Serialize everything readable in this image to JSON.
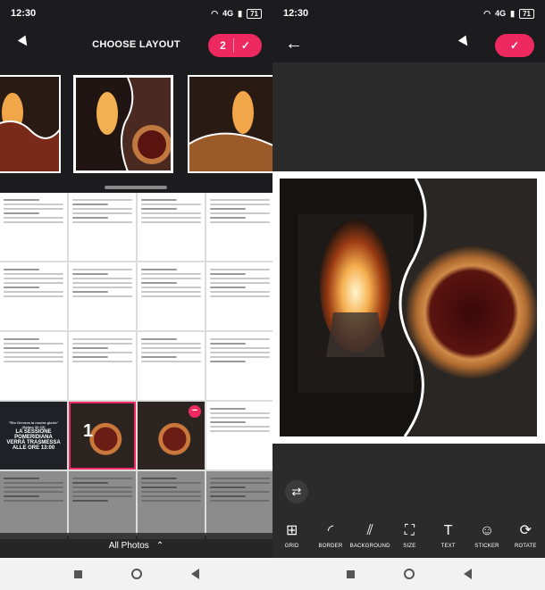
{
  "status": {
    "time_left": "12:30",
    "time_right": "12:30",
    "battery": "71",
    "network": "4G"
  },
  "left": {
    "title": "CHOOSE LAYOUT",
    "selected_count": "2",
    "check": "✓",
    "banner_lines": [
      "\"Rio Genova la nostra gloria\"",
      "(Salmo 30:15)",
      "LA SESSIONE POMERIDIANA",
      "VERRÀ TRASMESSA",
      "ALLE ORE 13:00"
    ],
    "selected_number": "1",
    "all_photos_label": "All Photos",
    "chevron": "⌃"
  },
  "right": {
    "back": "←",
    "check": "✓",
    "shuffle": "⇄",
    "tools": [
      {
        "label": "GRID",
        "icon": "grid-icon",
        "glyph": "⊞"
      },
      {
        "label": "BORDER",
        "icon": "border-icon",
        "glyph": "◜"
      },
      {
        "label": "BACKGROUND",
        "icon": "background-icon",
        "glyph": "⫽"
      },
      {
        "label": "SIZE",
        "icon": "size-icon",
        "glyph": "⛶"
      },
      {
        "label": "TEXT",
        "icon": "text-icon",
        "glyph": "T"
      },
      {
        "label": "STICKER",
        "icon": "sticker-icon",
        "glyph": "☺"
      },
      {
        "label": "ROTATE",
        "icon": "rotate-icon",
        "glyph": "⟳"
      }
    ]
  },
  "colors": {
    "accent": "#ee2961",
    "dark": "#1c1c1e",
    "editor_bg": "#2b2b2b"
  }
}
